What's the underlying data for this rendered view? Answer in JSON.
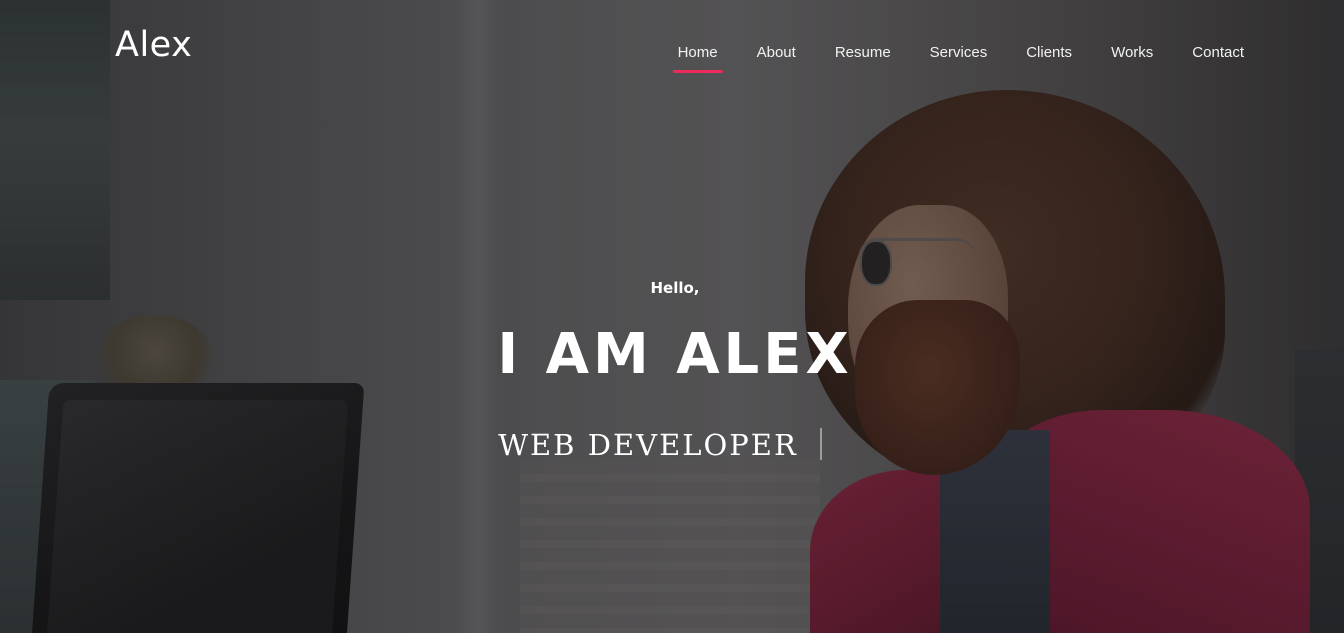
{
  "brand": {
    "logo_text": "Alex"
  },
  "nav": {
    "items": [
      {
        "label": "Home",
        "active": true
      },
      {
        "label": "About",
        "active": false
      },
      {
        "label": "Resume",
        "active": false
      },
      {
        "label": "Services",
        "active": false
      },
      {
        "label": "Clients",
        "active": false
      },
      {
        "label": "Works",
        "active": false
      },
      {
        "label": "Contact",
        "active": false
      }
    ],
    "active_color": "#ec2b5a"
  },
  "hero": {
    "greeting": "Hello,",
    "title": "I AM ALEX",
    "subtitle": "WEB DEVELOPER"
  }
}
